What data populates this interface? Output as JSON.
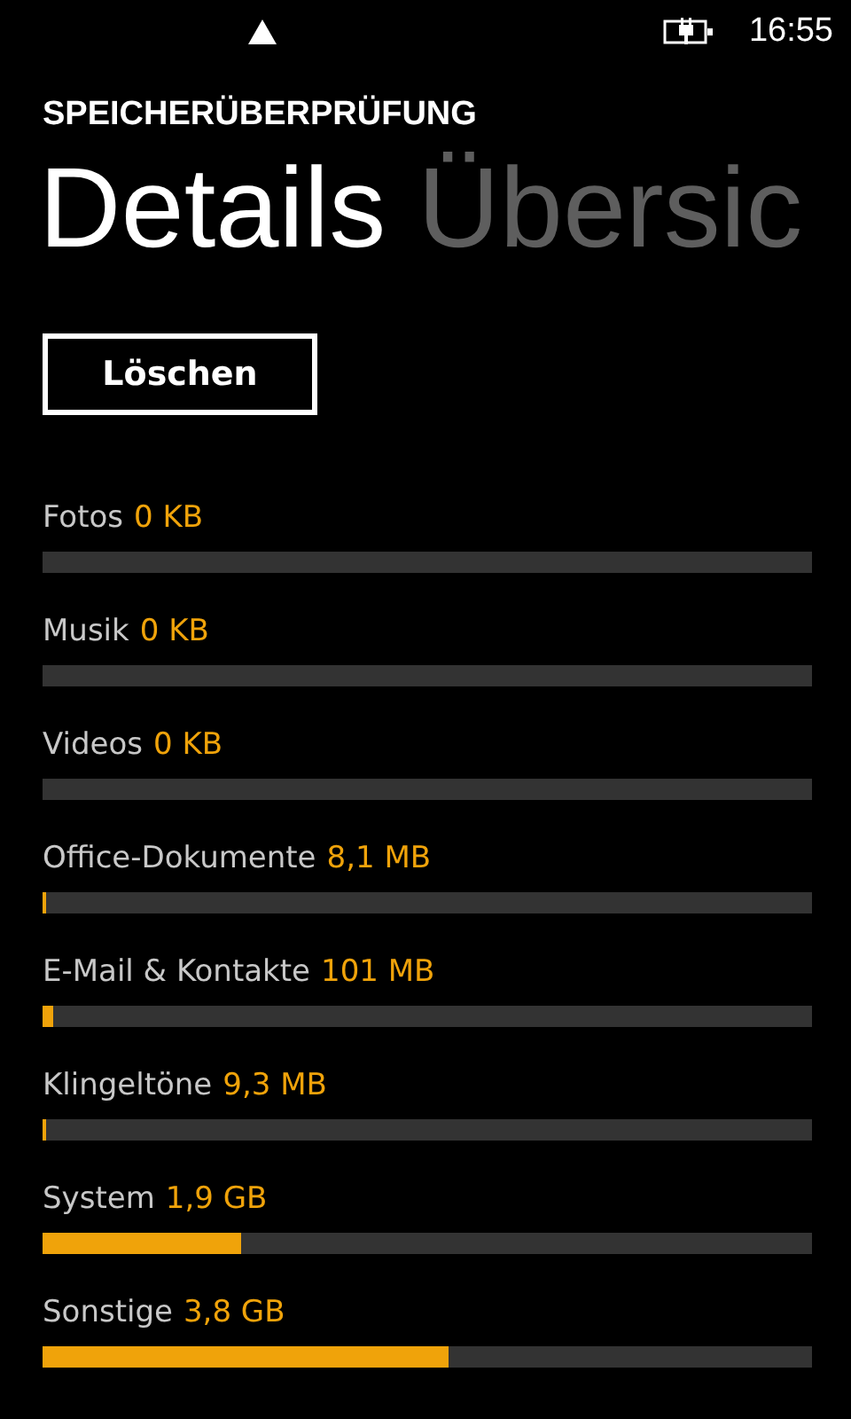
{
  "status_bar": {
    "time": "16:55"
  },
  "app_title": "SPEICHERÜBERPRÜFUNG",
  "pivot": [
    {
      "label": "Details",
      "selected": true
    },
    {
      "label": "Übersic",
      "selected": false
    }
  ],
  "button": "Löschen",
  "categories": [
    {
      "name": "Fotos",
      "size": "0 KB"
    },
    {
      "name": "Musik",
      "size": "0 KB"
    },
    {
      "name": "Videos",
      "size": "0 KB"
    },
    {
      "name": "Office-Dokumente",
      "size": "8,1 MB",
      "level": 0.003
    },
    {
      "name": "E-Mail & Kontakte",
      "size": "101 MB",
      "level": 0.013
    },
    {
      "name": "Klingeltöne",
      "size": "9,3 MB",
      "level": 0.003
    },
    {
      "name": "System",
      "size": "1,9 GB",
      "level": 0.258
    },
    {
      "name": "Sonstige",
      "size": "3,8 GB",
      "level": 0.528
    }
  ]
}
